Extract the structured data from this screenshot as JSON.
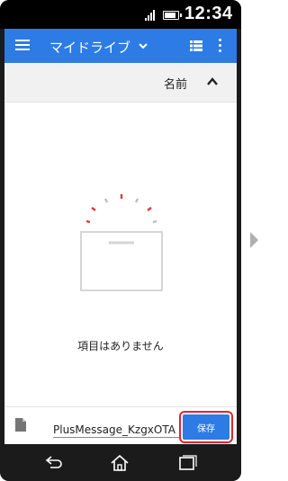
{
  "status_bar": {
    "time": "12:34"
  },
  "app_bar": {
    "title": "マイドライブ",
    "icons": [
      "menu-icon",
      "chevron-down-icon",
      "list-view-icon",
      "more-vert-icon"
    ]
  },
  "sort_bar": {
    "label": "名前",
    "icon": "chevron-up-icon"
  },
  "empty_state": {
    "message": "項目はありません",
    "icon": "empty-folder-icon"
  },
  "save_bar": {
    "file_icon": "file-icon",
    "filename_value": "PlusMessage_KzgxOTA",
    "save_label": "保存"
  },
  "nav_bar": {
    "icons": [
      "back-icon",
      "home-icon",
      "recent-apps-icon"
    ]
  },
  "colors": {
    "accent": "#2d7be5",
    "highlight": "#e0262b",
    "loader": "#e53935"
  }
}
